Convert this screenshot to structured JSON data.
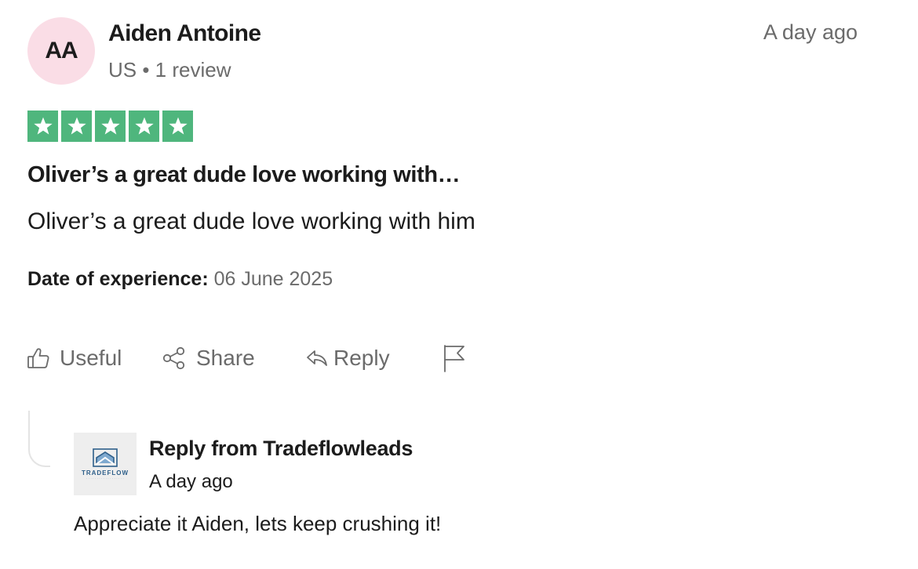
{
  "review": {
    "avatar_initials": "AA",
    "reviewer_name": "Aiden Antoine",
    "reviewer_meta": "US • 1 review",
    "posted": "A day ago",
    "rating": 5,
    "rating_max": 5,
    "star_color": "#4fb67d",
    "title": "Oliver’s a great dude love working with…",
    "body": "Oliver’s a great dude love working with him",
    "experience_label": "Date of experience:",
    "experience_date": "06 June 2025"
  },
  "actions": {
    "useful_label": "Useful",
    "share_label": "Share",
    "reply_label": "Reply",
    "icons": [
      "thumbs-up-icon",
      "share-icon",
      "reply-arrow-icon",
      "flag-icon"
    ]
  },
  "company_reply": {
    "logo_text": "TRADEFLOW",
    "heading": "Reply from Tradeflowleads",
    "posted": "A day ago",
    "body": "Appreciate it Aiden, lets keep crushing it!"
  }
}
